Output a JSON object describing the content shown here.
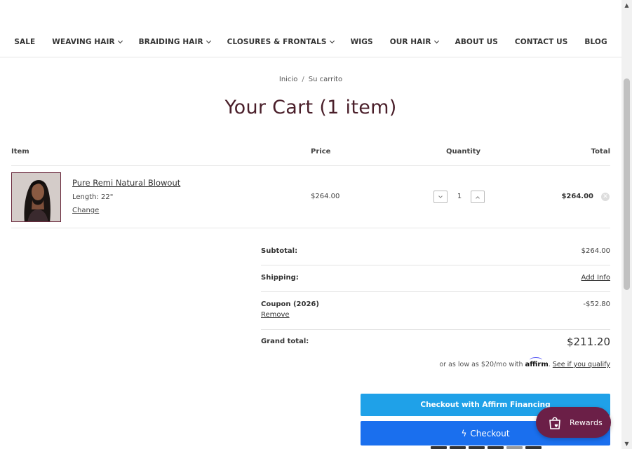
{
  "nav": {
    "items": [
      {
        "label": "SALE",
        "dropdown": false
      },
      {
        "label": "WEAVING HAIR",
        "dropdown": true
      },
      {
        "label": "BRAIDING HAIR",
        "dropdown": true
      },
      {
        "label": "CLOSURES & FRONTALS",
        "dropdown": true
      },
      {
        "label": "WIGS",
        "dropdown": false
      },
      {
        "label": "OUR HAIR",
        "dropdown": true
      },
      {
        "label": "ABOUT US",
        "dropdown": false
      },
      {
        "label": "CONTACT US",
        "dropdown": false
      },
      {
        "label": "BLOG",
        "dropdown": false
      }
    ]
  },
  "breadcrumb": {
    "home": "Inicio",
    "separator": "/",
    "current": "Su carrito"
  },
  "page": {
    "title": "Your Cart (1 item)"
  },
  "table": {
    "headers": {
      "item": "Item",
      "price": "Price",
      "quantity": "Quantity",
      "total": "Total"
    }
  },
  "cart_item": {
    "name": "Pure Remi Natural Blowout",
    "option": "Length: 22\"",
    "change_label": "Change",
    "price": "$264.00",
    "quantity": "1",
    "total": "$264.00"
  },
  "summary": {
    "subtotal_label": "Subtotal:",
    "subtotal_value": "$264.00",
    "shipping_label": "Shipping:",
    "shipping_action": "Add Info",
    "coupon_label": "Coupon (2026)",
    "coupon_value": "-$52.80",
    "coupon_remove": "Remove",
    "grand_label": "Grand total:",
    "grand_value": "$211.20"
  },
  "affirm": {
    "prefix": "or as low as $20/mo with",
    "logo": "affirm",
    "link": "See if you qualify"
  },
  "buttons": {
    "affirm_checkout": "Checkout with Affirm Financing",
    "checkout": "Checkout"
  },
  "rewards": {
    "label": "Rewards"
  },
  "colors": {
    "title": "#4a1f2a",
    "affirm_button": "#1fa1e8",
    "checkout_button": "#1a6fee",
    "rewards": "#6b1f47"
  }
}
